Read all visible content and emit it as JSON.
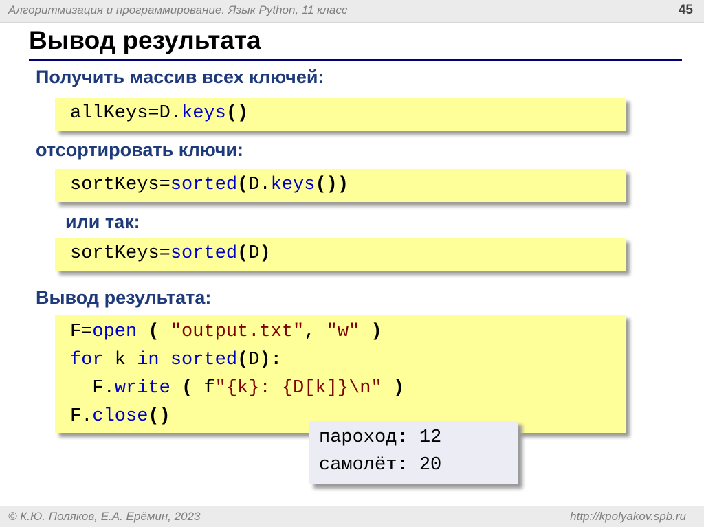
{
  "header": {
    "course": "Алгоритмизация и программирование. Язык Python, 11 класс",
    "page_number": "45"
  },
  "slide_title": "Вывод результата",
  "sections": {
    "get_keys_label": "Получить массив всех ключей:",
    "sort_keys_label": "отсортировать ключи:",
    "alt_label": "или так:",
    "output_label": "Вывод результата:"
  },
  "code1": {
    "var": "allKeys",
    "eq": "=",
    "obj": "D.",
    "method": "keys",
    "paren": "()"
  },
  "code2": {
    "var": "sortKeys",
    "eq": "=",
    "fn": "sorted",
    "open": "(",
    "obj": "D.",
    "method": "keys",
    "close": "())"
  },
  "code3": {
    "var": "sortKeys",
    "eq": "=",
    "fn": "sorted",
    "open": "(",
    "arg": "D",
    "close": ")"
  },
  "code4": {
    "l1_var": "F",
    "l1_eq": "=",
    "l1_fn": "open",
    "l1_open": " ( ",
    "l1_s1": "\"output.txt\"",
    "l1_comma": ", ",
    "l1_s2": "\"w\"",
    "l1_close": " )",
    "l2_for": "for",
    "l2_var": " k ",
    "l2_in": "in",
    "l2_sp": " ",
    "l2_fn": "sorted",
    "l2_open": "(",
    "l2_arg": "D",
    "l2_close": "):",
    "l3_indent": "  ",
    "l3_obj": "F.",
    "l3_method": "write",
    "l3_open": " ( ",
    "l3_f": "f",
    "l3_str": "\"{k}: {D[k]}\\n\"",
    "l3_close": " )",
    "l4_obj": "F.",
    "l4_method": "close",
    "l4_paren": "()"
  },
  "output": {
    "line1": "пароход: 12",
    "line2": "самолёт: 20"
  },
  "footer": {
    "author": "© К.Ю. Поляков, Е.А. Ерёмин, 2023",
    "url": "http://kpolyakov.spb.ru"
  }
}
